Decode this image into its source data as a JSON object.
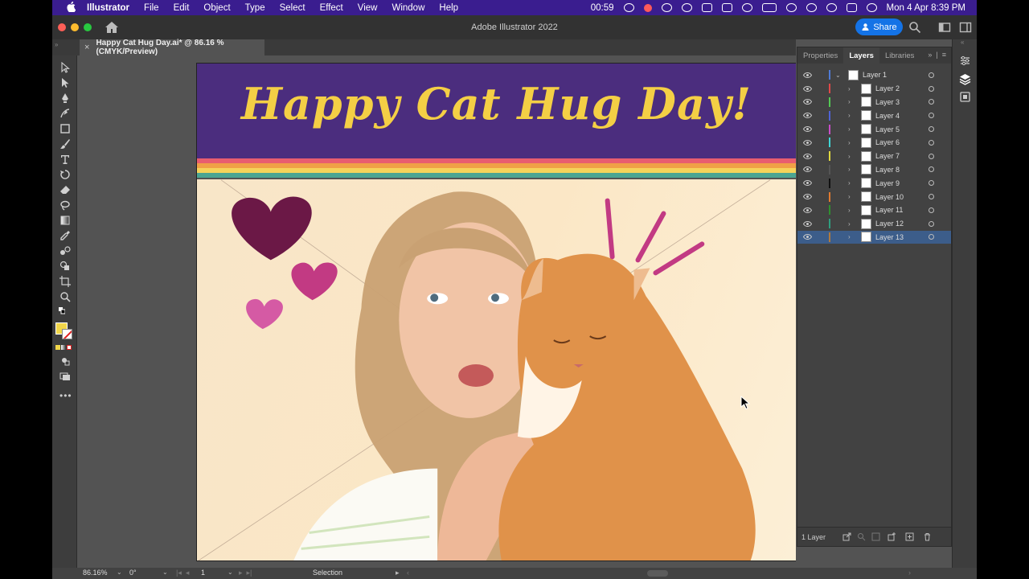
{
  "menubar": {
    "apple": "",
    "app_name": "Illustrator",
    "items": [
      "File",
      "Edit",
      "Object",
      "Type",
      "Select",
      "Effect",
      "View",
      "Window",
      "Help"
    ],
    "timer": "00:59",
    "clock": "Mon 4 Apr  8:39 PM"
  },
  "titlebar": {
    "title": "Adobe Illustrator 2022",
    "share_label": "Share"
  },
  "document_tab": {
    "close": "×",
    "label": "Happy Cat Hug Day.ai* @ 86.16 % (CMYK/Preview)"
  },
  "artboard": {
    "title": "Happy Cat Hug Day!",
    "colors": {
      "header": "#4b2d7e",
      "title": "#f4cf45",
      "stripes": [
        "#e85d6f",
        "#f0a046",
        "#f5d35a",
        "#4ba592"
      ],
      "heart_dark": "#6b1846",
      "heart_mid": "#c23a83",
      "heart_light": "#d55aa4",
      "accent_lines": "#c23a83"
    }
  },
  "layers_panel": {
    "tabs": [
      "Properties",
      "Layers",
      "Libraries"
    ],
    "active_tab": "Layers",
    "layers": [
      {
        "name": "Layer 1",
        "color": "#4f7bd6",
        "level": 0,
        "selected": false
      },
      {
        "name": "Layer 2",
        "color": "#e04848",
        "level": 1,
        "selected": false
      },
      {
        "name": "Layer 3",
        "color": "#53c953",
        "level": 1,
        "selected": false
      },
      {
        "name": "Layer 4",
        "color": "#4f63d6",
        "level": 1,
        "selected": false
      },
      {
        "name": "Layer 5",
        "color": "#c84ec8",
        "level": 1,
        "selected": false
      },
      {
        "name": "Layer 6",
        "color": "#3fd6d6",
        "level": 1,
        "selected": false
      },
      {
        "name": "Layer 7",
        "color": "#e0d840",
        "level": 1,
        "selected": false
      },
      {
        "name": "Layer 8",
        "color": "#555555",
        "level": 1,
        "selected": false
      },
      {
        "name": "Layer 9",
        "color": "#111111",
        "level": 1,
        "selected": false
      },
      {
        "name": "Layer 10",
        "color": "#e07a30",
        "level": 1,
        "selected": false
      },
      {
        "name": "Layer 11",
        "color": "#2f8f2f",
        "level": 1,
        "selected": false
      },
      {
        "name": "Layer 12",
        "color": "#2f9f7f",
        "level": 1,
        "selected": false
      },
      {
        "name": "Layer 13",
        "color": "#b07a3f",
        "level": 1,
        "selected": true
      }
    ],
    "footer_label": "1 Layer"
  },
  "statusbar": {
    "zoom": "86.16%",
    "rotation": "0°",
    "artboard_number": "1",
    "tool_name": "Selection"
  },
  "colors": {
    "fill_swatch": "#f1d64a",
    "accent": "#1473e6"
  },
  "icons": {
    "tools": [
      "selection-tool-icon",
      "direct-selection-tool-icon",
      "pen-tool-icon",
      "curvature-tool-icon",
      "rectangle-tool-icon",
      "paintbrush-tool-icon",
      "type-tool-icon",
      "rotate-tool-icon",
      "eraser-tool-icon",
      "lasso-tool-icon",
      "gradient-tool-icon",
      "eyedropper-tool-icon",
      "blend-tool-icon",
      "shape-builder-tool-icon",
      "artboard-tool-icon",
      "zoom-tool-icon"
    ]
  }
}
